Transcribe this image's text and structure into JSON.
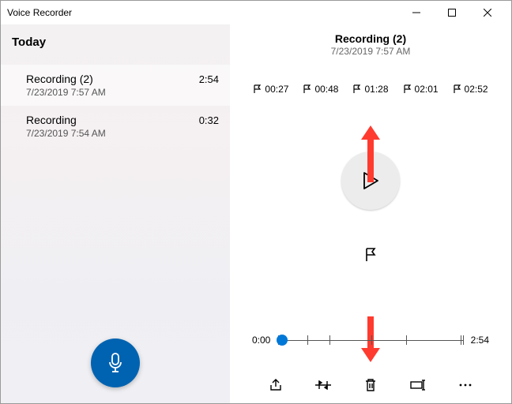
{
  "window": {
    "title": "Voice Recorder"
  },
  "sidebar": {
    "section": "Today",
    "items": [
      {
        "name": "Recording (2)",
        "date": "7/23/2019 7:57 AM",
        "duration": "2:54",
        "selected": true
      },
      {
        "name": "Recording",
        "date": "7/23/2019 7:54 AM",
        "duration": "0:32",
        "selected": false
      }
    ]
  },
  "main": {
    "title": "Recording (2)",
    "subtitle": "7/23/2019 7:57 AM",
    "markers": [
      "00:27",
      "00:48",
      "01:28",
      "02:01",
      "02:52"
    ],
    "timeline": {
      "start": "0:00",
      "end": "2:54",
      "ticks_percent": [
        15.5,
        27.6,
        50.6,
        69.5,
        98.9
      ]
    },
    "colors": {
      "accent": "#0078d7",
      "record": "#0063b1"
    }
  },
  "annotations": {
    "arrow_up": {
      "visible": true,
      "color": "#ff3b2f"
    },
    "arrow_down": {
      "visible": true,
      "color": "#ff3b2f"
    }
  }
}
